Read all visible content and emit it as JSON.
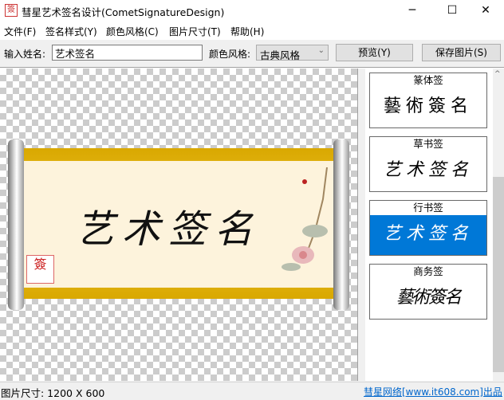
{
  "window": {
    "title": "彗星艺术签名设计(CometSignatureDesign)",
    "icon_text": "簽",
    "minimize": "─",
    "maximize": "☐",
    "close": "✕"
  },
  "menu": [
    "文件(F)",
    "签名样式(Y)",
    "颜色风格(C)",
    "图片尺寸(T)",
    "帮助(H)"
  ],
  "toolbar": {
    "name_label": "输入姓名:",
    "name_value": "艺术签名",
    "color_label": "颜色风格:",
    "color_value": "古典风格",
    "preview_label": "预览(Y)",
    "save_label": "保存图片(S)"
  },
  "preview": {
    "signature": "艺术签名",
    "seal_text": "簽"
  },
  "styles": [
    {
      "title": "篆体签",
      "sample": "藝術簽名",
      "selected": false
    },
    {
      "title": "草书签",
      "sample": "艺术签名",
      "selected": false
    },
    {
      "title": "行书签",
      "sample": "艺术签名",
      "selected": true
    },
    {
      "title": "商务签",
      "sample": "藝術簽名",
      "selected": false
    }
  ],
  "status": {
    "size": "图片尺寸: 1200 X 600",
    "link": "彗星网络[www.it608.com]出品"
  },
  "colors": {
    "accent": "#0078d7",
    "link": "#0066cc"
  }
}
